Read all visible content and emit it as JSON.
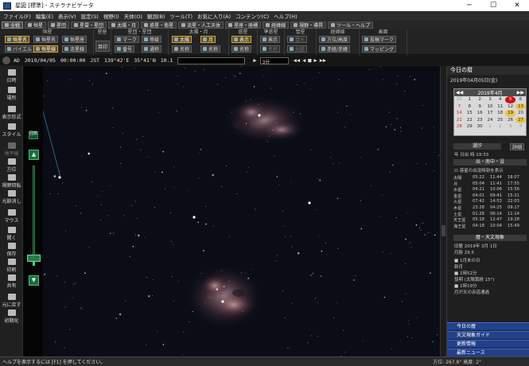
{
  "window": {
    "title": "星図 [標準] - ステラナビゲータ",
    "controls": [
      "minimize",
      "maximize",
      "close"
    ]
  },
  "menu": [
    "ファイル(F)",
    "編集(E)",
    "表示(V)",
    "設定(S)",
    "視野(I)",
    "天体(O)",
    "観測(B)",
    "ツール(T)",
    "お気に入り(A)",
    "コンテンツ(C)",
    "ヘルプ(H)"
  ],
  "toolbar": {
    "items": [
      "全戦",
      "恒星",
      "星団",
      "星雲・星団",
      "太陽・月",
      "惑星・衛星",
      "流星・人工天体",
      "星座・座標",
      "経緯線",
      "視野・導昇",
      "ツール・ヘルプ"
    ]
  },
  "groups": {
    "seiza": {
      "title": "恒星",
      "buttons": [
        "恒星名",
        "恒星名",
        "恒星座",
        "バイエル",
        "恒星線",
        "流星線"
      ]
    },
    "hoshi": {
      "title": "星座",
      "buttons": [
        "目印"
      ]
    },
    "seidan": {
      "title": "星団・星団",
      "buttons": [
        "マーク",
        "番号",
        "等級",
        "通称"
      ]
    },
    "taiyo": {
      "title": "太陽・月",
      "buttons": [
        "太陽",
        "月",
        "名称",
        "名称"
      ]
    },
    "wakusei": {
      "title": "惑星",
      "buttons": [
        "表示",
        "名称"
      ]
    },
    "eisei": {
      "title": "準惑星",
      "buttons": [
        "表示",
        "名称"
      ]
    },
    "suisei": {
      "title": "彗星",
      "buttons": [
        "彗光",
        "光跡"
      ]
    },
    "keii": {
      "title": "経緯線",
      "buttons": [
        "方位/高度",
        "赤経/赤緯"
      ]
    },
    "gamen": {
      "title": "画面",
      "buttons": [
        "投稿マーク",
        "マッピング"
      ]
    }
  },
  "datebar": {
    "era": "AD",
    "date": "2019/04/05",
    "time": "00:00:00",
    "tz": "JST",
    "longitude": "139°42'E",
    "latitude": "35°41'N",
    "zoom": "10.1",
    "step": "3分"
  },
  "sidebar": [
    {
      "label": "日時",
      "dim": false
    },
    {
      "label": "場所",
      "dim": false
    },
    {
      "label": "表示形式",
      "dim": false
    },
    {
      "label": "スタイル",
      "dim": false
    },
    {
      "label": "地平線",
      "dim": true
    },
    {
      "label": "方位",
      "dim": false
    },
    {
      "label": "視野回転",
      "dim": false
    },
    {
      "label": "光跡消し",
      "dim": false
    },
    {
      "label": "マウス",
      "dim": false
    },
    {
      "label": "開く",
      "dim": false
    },
    {
      "label": "保存",
      "dim": false
    },
    {
      "label": "印刷",
      "dim": false
    },
    {
      "label": "共有",
      "dim": false
    },
    {
      "label": "元に戻す",
      "dim": false
    },
    {
      "label": "初期化",
      "dim": false
    }
  ],
  "zoom": {
    "label": "回数",
    "up": "▲",
    "down": "▼",
    "level": 0.08
  },
  "right_panel": {
    "title": "今日の暦",
    "date": "2019年04月05日(金)",
    "calendar": {
      "prev": "◀◀",
      "month": "2019年4月",
      "next": "▶▶",
      "weeks": [
        [
          "31",
          "1",
          "2",
          "3",
          "4",
          "5",
          "6"
        ],
        [
          "7",
          "8",
          "9",
          "10",
          "11",
          "12",
          "13"
        ],
        [
          "14",
          "15",
          "16",
          "17",
          "18",
          "19",
          "20"
        ],
        [
          "21",
          "22",
          "23",
          "24",
          "25",
          "26",
          "27"
        ],
        [
          "28",
          "29",
          "30",
          "1",
          "2",
          "3",
          "4"
        ]
      ]
    },
    "lunar_title": "潮汐",
    "lunar_line": "年 日出  時 19:33",
    "rise_button": "詳細",
    "rise_section": "出・南中・没",
    "show_option": "惑星の出没時刻を表示",
    "planets": [
      [
        "太陽",
        "05:22",
        "11:44",
        "18:07"
      ],
      [
        "月",
        "05:04",
        "11:41",
        "17:55"
      ],
      [
        "水星",
        "04:21",
        "10:06",
        "15:56"
      ],
      [
        "金星",
        "04:01",
        "09:41",
        "15:21"
      ],
      [
        "火星",
        "07:42",
        "14:53",
        "22:03"
      ],
      [
        "木星",
        "23:28",
        "04:25",
        "09:17"
      ],
      [
        "土星",
        "01:28",
        "06:14",
        "11:14"
      ],
      [
        "天王星",
        "05:18",
        "12:47",
        "19:28"
      ],
      [
        "海王星",
        "04:18",
        "10:04",
        "15:49"
      ]
    ],
    "phenomena_title": "暦・天文現象",
    "phenomena": [
      "旧暦 2019年 3月 1日",
      "月齢 29.5",
      "■ 1月末の日",
      "  新月",
      "■ 1時52分",
      "  彗明 (太陽黄経 15°)",
      "■ 1時19分",
      "  月が天の赤道通過"
    ],
    "tabs": [
      "今日の暦",
      "天文現象ガイド",
      "更新情報",
      "最新ニュース"
    ]
  },
  "status": {
    "left": "ヘルプを表示するには [F1] を押してください。",
    "right": "方位: 267.8°  高度: 2°"
  }
}
